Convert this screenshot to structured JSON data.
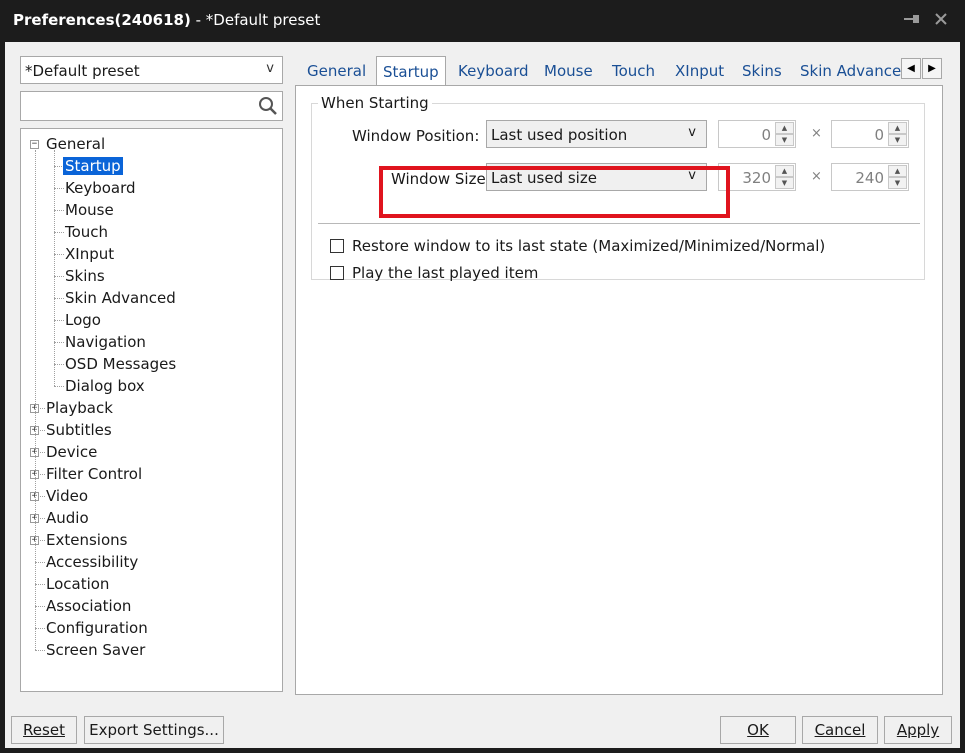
{
  "window": {
    "title_bold": "Preferences(240618)",
    "title_rest": " - *Default preset"
  },
  "preset": {
    "selected": "*Default preset"
  },
  "search": {
    "value": ""
  },
  "tree": {
    "general": "General",
    "general_children": [
      "Startup",
      "Keyboard",
      "Mouse",
      "Touch",
      "XInput",
      "Skins",
      "Skin Advanced",
      "Logo",
      "Navigation",
      "OSD Messages",
      "Dialog box"
    ],
    "expandable": [
      "Playback",
      "Subtitles",
      "Device",
      "Filter Control",
      "Video",
      "Audio",
      "Extensions"
    ],
    "leaves": [
      "Accessibility",
      "Location",
      "Association",
      "Configuration",
      "Screen Saver"
    ],
    "selected": "Startup"
  },
  "tabs": [
    "General",
    "Startup",
    "Keyboard",
    "Mouse",
    "Touch",
    "XInput",
    "Skins",
    "Skin Advanced"
  ],
  "active_tab": "Startup",
  "startup": {
    "group_title": "When Starting",
    "position_label": "Window Position:",
    "position_value": "Last used position",
    "pos_x": "0",
    "pos_y": "0",
    "size_label": "Window Size:",
    "size_value": "Last used size",
    "size_w": "320",
    "size_h": "240",
    "times": "×",
    "restore_label": "Restore window to its last state (Maximized/Minimized/Normal)",
    "restore_checked": false,
    "play_last_label": "Play the last played item",
    "play_last_checked": false
  },
  "buttons": {
    "reset": "Reset",
    "export": "Export Settings...",
    "ok": "OK",
    "cancel": "Cancel",
    "apply": "Apply"
  },
  "colors": {
    "selection": "#0a64d8",
    "highlight_box": "#e0141e",
    "tab_text": "#1a4f95"
  }
}
